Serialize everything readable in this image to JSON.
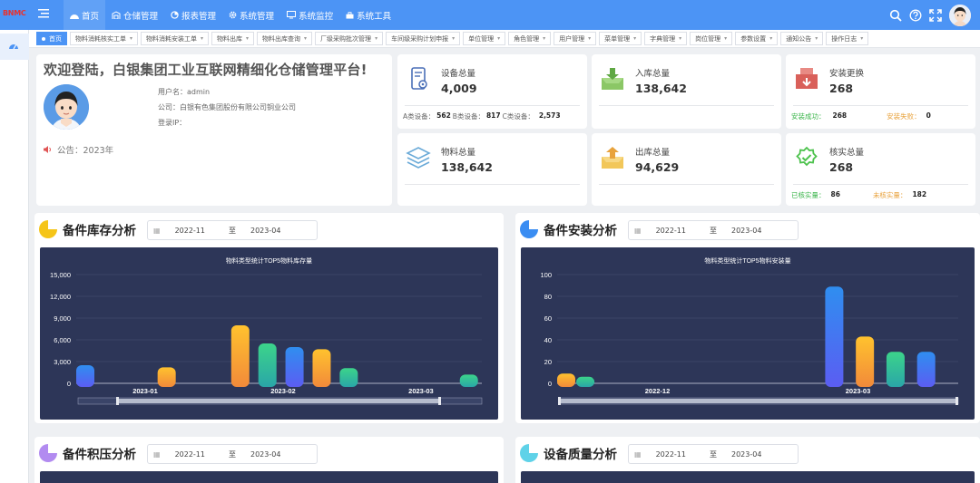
{
  "app": {
    "logo": "BNMC"
  },
  "nav": [
    {
      "label": "首页",
      "icon": "dashboard-icon"
    },
    {
      "label": "仓储管理",
      "icon": "warehouse-icon"
    },
    {
      "label": "报表管理",
      "icon": "pie-chart-icon"
    },
    {
      "label": "系统管理",
      "icon": "gear-icon"
    },
    {
      "label": "系统监控",
      "icon": "monitor-icon"
    },
    {
      "label": "系统工具",
      "icon": "toolbox-icon"
    }
  ],
  "tabs": [
    "首页",
    "物料消耗核实工单",
    "物料消耗安装工单",
    "物料出库",
    "物料出库查询",
    "厂级采购批次管理",
    "车间级采购计划申报",
    "单位管理",
    "角色管理",
    "用户管理",
    "菜单管理",
    "字典管理",
    "岗位管理",
    "参数设置",
    "通知公告",
    "操作日志"
  ],
  "welcome": {
    "title": "欢迎登陆，白银集团工业互联网精细化仓储管理平台!",
    "username": "用户名：admin",
    "company": "公司：白银有色集团股份有限公司铜业公司",
    "ip": "登录IP：",
    "notice": "公告：2023年"
  },
  "stats": {
    "equipment": {
      "label": "设备总量",
      "value": "4,009",
      "a_label": "A类设备：",
      "a_value": "562",
      "b_label": "B类设备：",
      "b_value": "817",
      "c_label": "C类设备：",
      "c_value": "2,573"
    },
    "inbound": {
      "label": "入库总量",
      "value": "138,642"
    },
    "install": {
      "label": "安装更换",
      "value": "268",
      "ok_label": "安装成功：",
      "ok_value": "268",
      "fail_label": "安装失败：",
      "fail_value": "0"
    },
    "material": {
      "label": "物料总量",
      "value": "138,642"
    },
    "outbound": {
      "label": "出库总量",
      "value": "94,629"
    },
    "verify": {
      "label": "核实总量",
      "value": "268",
      "done_label": "已核实量：",
      "done_value": "86",
      "todo_label": "未核实量：",
      "todo_value": "182"
    }
  },
  "panels": {
    "stock": {
      "title": "备件库存分析",
      "date_from": "2022-11",
      "sep": "至",
      "date_to": "2023-04",
      "color": "#f5c518"
    },
    "install": {
      "title": "备件安装分析",
      "date_from": "2022-11",
      "sep": "至",
      "date_to": "2023-04",
      "color": "#3a8df2"
    },
    "backlog": {
      "title": "备件积压分析",
      "date_from": "2022-11",
      "sep": "至",
      "date_to": "2023-04",
      "color": "#b28bf0"
    },
    "quality": {
      "title": "设备质量分析",
      "date_from": "2022-11",
      "sep": "至",
      "date_to": "2023-04",
      "color": "#5fd2e8"
    }
  },
  "chart_data": [
    {
      "type": "bar",
      "title": "物料类型统计TOP5物料库存量",
      "ylim": [
        0,
        15000
      ],
      "yticks": [
        "15,000",
        "12,000",
        "9,000",
        "6,000",
        "3,000",
        "0"
      ],
      "xticks": [
        "2023-01",
        "2023-02",
        "2023-03"
      ],
      "bars": [
        {
          "x": 0.0,
          "value": 2500,
          "color": "blue"
        },
        {
          "x": 0.21,
          "value": 2200,
          "color": "orange"
        },
        {
          "x": 0.4,
          "value": 8000,
          "color": "orange"
        },
        {
          "x": 0.47,
          "value": 5500,
          "color": "green"
        },
        {
          "x": 0.54,
          "value": 5000,
          "color": "blue"
        },
        {
          "x": 0.61,
          "value": 4700,
          "color": "orange"
        },
        {
          "x": 0.68,
          "value": 2100,
          "color": "green"
        },
        {
          "x": 0.99,
          "value": 1200,
          "color": "green"
        }
      ]
    },
    {
      "type": "bar",
      "title": "物料类型统计TOP5物料安装量",
      "ylim": [
        0,
        100
      ],
      "yticks": [
        "100",
        "80",
        "60",
        "40",
        "20",
        "0"
      ],
      "xticks": [
        "2022-12",
        "2023-03"
      ],
      "bars": [
        {
          "x": 0.0,
          "value": 9,
          "color": "orange"
        },
        {
          "x": 0.05,
          "value": 6,
          "color": "green"
        },
        {
          "x": 0.7,
          "value": 89,
          "color": "blue"
        },
        {
          "x": 0.78,
          "value": 43,
          "color": "orange"
        },
        {
          "x": 0.86,
          "value": 29,
          "color": "green"
        },
        {
          "x": 0.94,
          "value": 29,
          "color": "blue"
        }
      ]
    }
  ]
}
